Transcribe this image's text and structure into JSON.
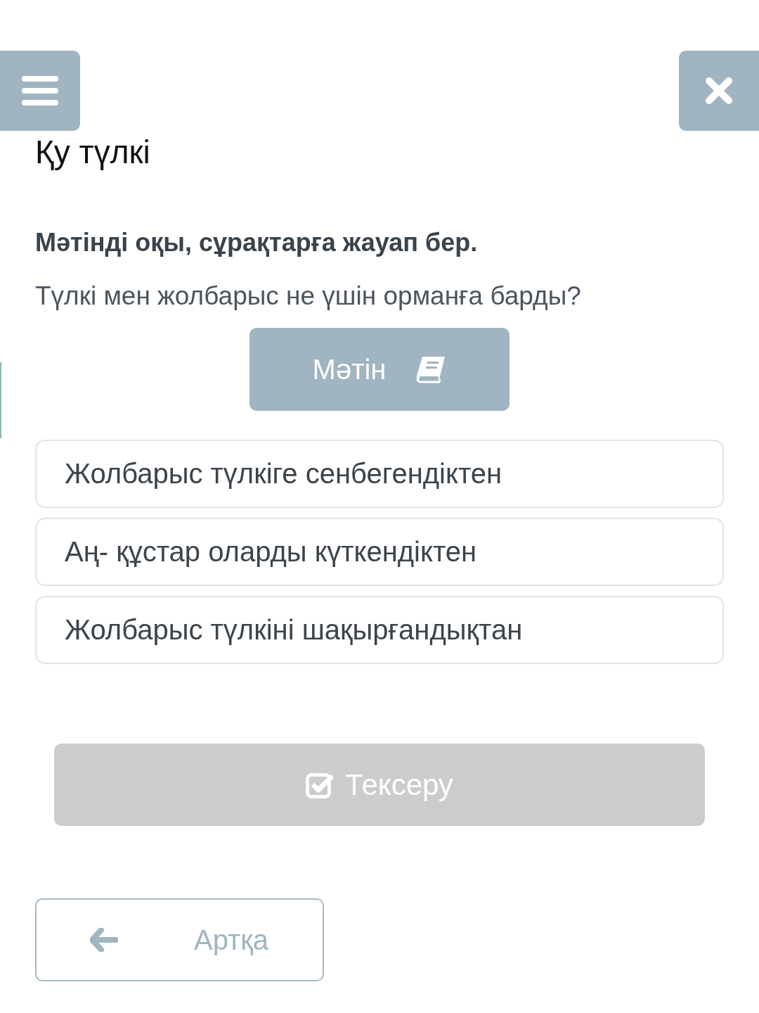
{
  "title": "Қу түлкі",
  "instruction": "Мәтінді оқы, сұрақтарға жауап бер.",
  "question": "Түлкі мен жолбарыс не үшін орманға барды?",
  "text_button": {
    "label": "Мәтін"
  },
  "options": [
    {
      "label": "Жолбарыс түлкіге сенбегендіктен",
      "selected": false
    },
    {
      "label": "Аң- құстар оларды күткендіктен",
      "selected": false
    },
    {
      "label": "Жолбарыс түлкіні шақырғандықтан",
      "selected": false
    }
  ],
  "check_button": {
    "label": "Тексеру",
    "disabled": true
  },
  "back_button": {
    "label": "Артқа"
  }
}
